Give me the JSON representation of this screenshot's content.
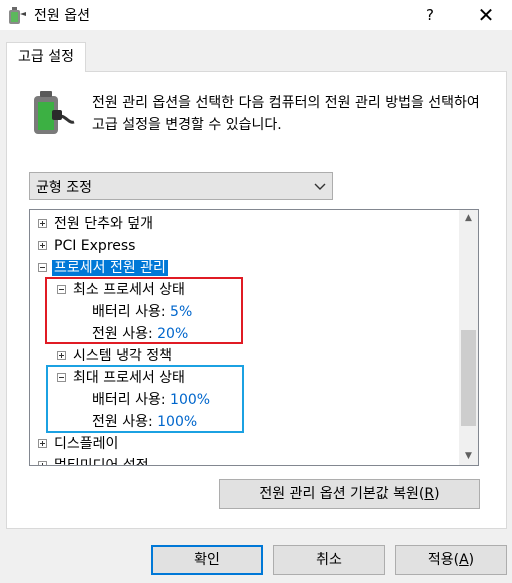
{
  "window": {
    "title": "전원 옵션",
    "help_label": "?",
    "close_label": "✕"
  },
  "tab": {
    "label": "고급 설정"
  },
  "description": "전원 관리 옵션을 선택한 다음 컴퓨터의 전원 관리 방법을 선택하여 고급 설정을 변경할 수 있습니다.",
  "plan_select": {
    "value": "균형 조정"
  },
  "tree": {
    "items": [
      {
        "label": "전원 단추와 덮개",
        "expander": "+"
      },
      {
        "label": "PCI Express",
        "expander": "+"
      },
      {
        "label": "프로세서 전원 관리",
        "expander": "-",
        "selected": true
      },
      {
        "label": "최소 프로세서 상태",
        "expander": "-"
      },
      {
        "label": "배터리 사용:",
        "value": "5%"
      },
      {
        "label": "전원 사용:",
        "value": "20%"
      },
      {
        "label": "시스템 냉각 정책",
        "expander": "+"
      },
      {
        "label": "최대 프로세서 상태",
        "expander": "-"
      },
      {
        "label": "배터리 사용:",
        "value": "100%"
      },
      {
        "label": "전원 사용:",
        "value": "100%"
      },
      {
        "label": "디스플레이",
        "expander": "+"
      },
      {
        "label": "멀티미디어 설정",
        "expander": "+"
      }
    ]
  },
  "buttons": {
    "restore": {
      "label": "전원 관리 옵션 기본값 복원(",
      "mnemonic": "R",
      "suffix": ")"
    },
    "ok": "확인",
    "cancel": "취소",
    "apply": {
      "label": "적용(",
      "mnemonic": "A",
      "suffix": ")"
    }
  },
  "colors": {
    "accent": "#0078d7",
    "value_text": "#0066cc",
    "highlight_red": "#e01b24",
    "highlight_blue": "#1ba1e2"
  }
}
